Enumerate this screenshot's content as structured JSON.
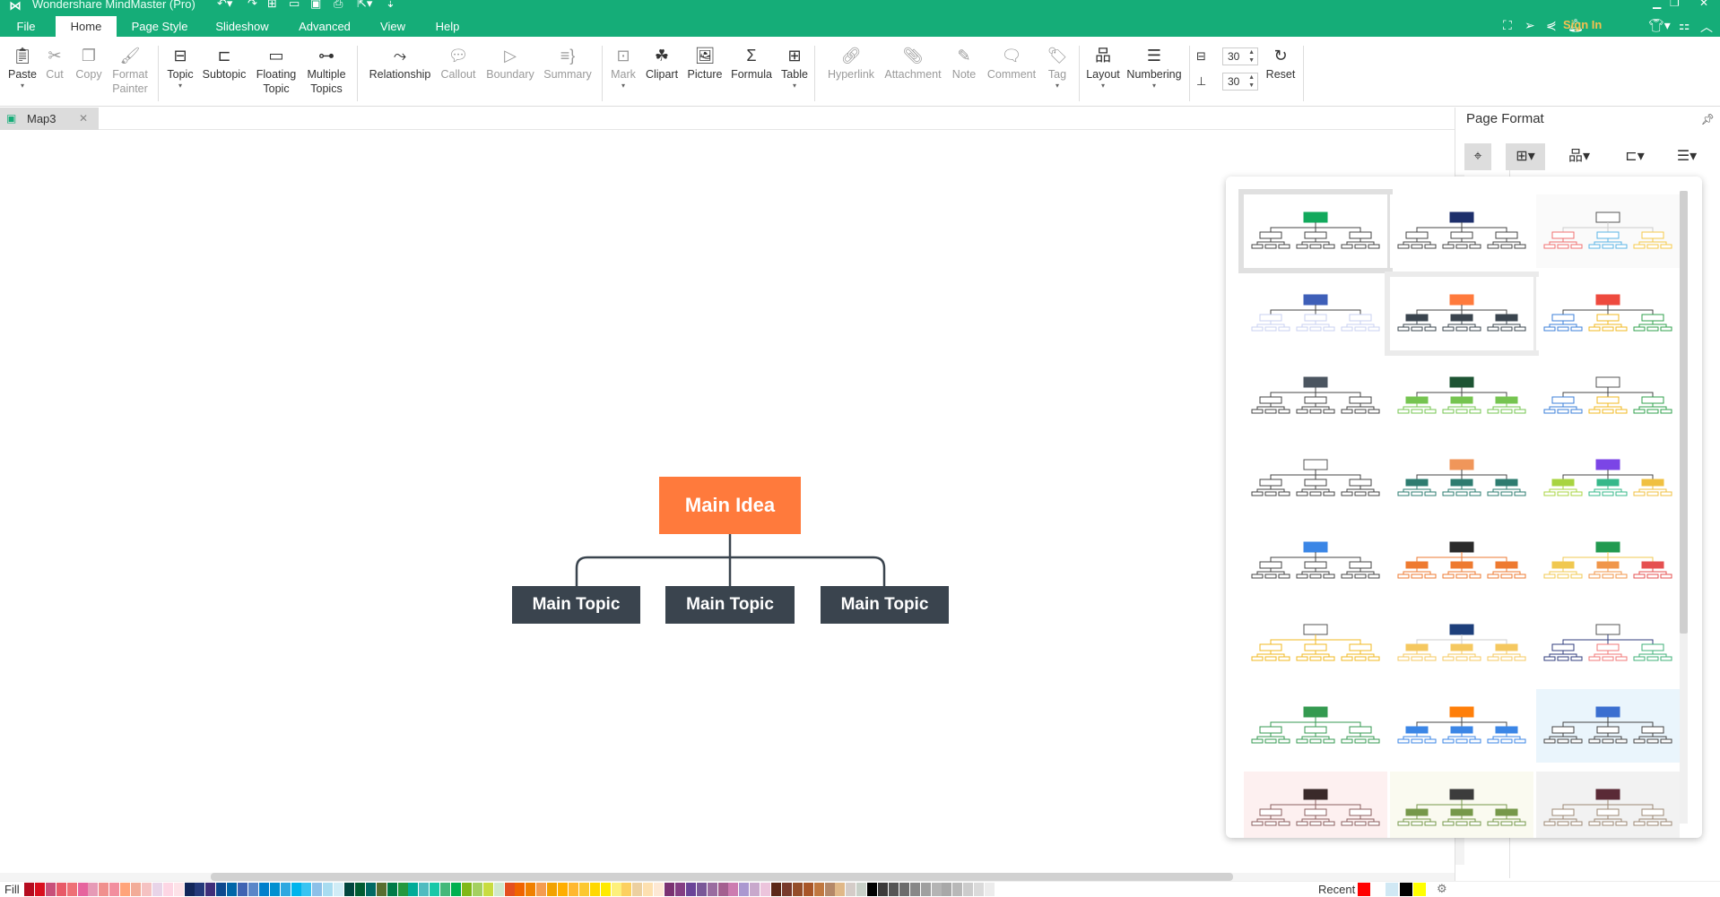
{
  "app": {
    "title": "Wondershare MindMaster (Pro)",
    "logo_icon": "mindmaster-logo-icon"
  },
  "quick_access": [
    "undo-icon",
    "redo-icon",
    "new-icon",
    "open-icon",
    "save-icon",
    "print-icon",
    "export-icon",
    "customize-icon"
  ],
  "menu": {
    "items": [
      "File",
      "Home",
      "Page Style",
      "Slideshow",
      "Advanced",
      "View",
      "Help"
    ],
    "active": "Home"
  },
  "topright": {
    "sign_in": "Sign In"
  },
  "ribbon": {
    "groups": [
      [
        {
          "label": "Paste",
          "icon": "paste-icon",
          "disabled": false,
          "dropdown": true
        },
        {
          "label": "Cut",
          "icon": "cut-icon",
          "disabled": true
        },
        {
          "label": "Copy",
          "icon": "copy-icon",
          "disabled": true
        },
        {
          "label": "Format\nPainter",
          "icon": "format-painter-icon",
          "disabled": true
        }
      ],
      [
        {
          "label": "Topic",
          "icon": "topic-icon",
          "disabled": false,
          "dropdown": true
        },
        {
          "label": "Subtopic",
          "icon": "subtopic-icon",
          "disabled": false
        },
        {
          "label": "Floating\nTopic",
          "icon": "floating-topic-icon",
          "disabled": false
        },
        {
          "label": "Multiple\nTopics",
          "icon": "multiple-topics-icon",
          "disabled": false
        }
      ],
      [
        {
          "label": "Relationship",
          "icon": "relationship-icon",
          "disabled": false
        },
        {
          "label": "Callout",
          "icon": "callout-icon",
          "disabled": true
        },
        {
          "label": "Boundary",
          "icon": "boundary-icon",
          "disabled": true
        },
        {
          "label": "Summary",
          "icon": "summary-icon",
          "disabled": true
        }
      ],
      [
        {
          "label": "Mark",
          "icon": "mark-icon",
          "disabled": true,
          "dropdown": true
        },
        {
          "label": "Clipart",
          "icon": "clipart-icon",
          "disabled": false
        },
        {
          "label": "Picture",
          "icon": "picture-icon",
          "disabled": false
        },
        {
          "label": "Formula",
          "icon": "formula-icon",
          "disabled": false
        },
        {
          "label": "Table",
          "icon": "table-icon",
          "disabled": false,
          "dropdown": true
        }
      ],
      [
        {
          "label": "Hyperlink",
          "icon": "hyperlink-icon",
          "disabled": true
        },
        {
          "label": "Attachment",
          "icon": "attachment-icon",
          "disabled": true
        },
        {
          "label": "Note",
          "icon": "note-icon",
          "disabled": true
        },
        {
          "label": "Comment",
          "icon": "comment-icon",
          "disabled": true
        },
        {
          "label": "Tag",
          "icon": "tag-icon",
          "disabled": true,
          "dropdown": true
        }
      ],
      [
        {
          "label": "Layout",
          "icon": "layout-icon",
          "disabled": false,
          "dropdown": true
        },
        {
          "label": "Numbering",
          "icon": "numbering-icon",
          "disabled": false,
          "dropdown": true
        }
      ]
    ],
    "spacing": {
      "horizontal_value": "30",
      "vertical_value": "30",
      "reset_label": "Reset"
    }
  },
  "document_tab": {
    "name": "Map3"
  },
  "mindmap": {
    "root": {
      "label": "Main Idea",
      "color": "#ff7a3c"
    },
    "topics": [
      {
        "label": "Main Topic",
        "color": "#3a444e"
      },
      {
        "label": "Main Topic",
        "color": "#3a444e"
      },
      {
        "label": "Main Topic",
        "color": "#3a444e"
      }
    ],
    "connector_color": "#3a444e"
  },
  "page_format": {
    "title": "Page Format",
    "toolbar": [
      "format-icon",
      "theme-icon",
      "layout-structure-icon",
      "connector-style-icon",
      "numbering-list-icon"
    ],
    "selected_tool": "theme-icon"
  },
  "themes": [
    {
      "root": "#12a95c",
      "topic": "outline",
      "topicColor": "#444",
      "line": "#444",
      "bg": "#ffffff",
      "selected": true
    },
    {
      "root": "#1d2f6b",
      "topic": "outline",
      "topicColor": "#444",
      "line": "#444",
      "bg": "#ffffff"
    },
    {
      "root": "outline",
      "topic": "outline",
      "multi": [
        "#f07070",
        "#5bb4e6",
        "#f5c94a"
      ],
      "line": "#ccc",
      "bg": "#fafafa"
    },
    {
      "root": "#3e5fb8",
      "topic": "outline",
      "topicColor": "#c9d0f2",
      "line": "#444",
      "bg": "#ffffff"
    },
    {
      "root": "#ff7a3c",
      "topic": "fill",
      "topicColor": "#3a444e",
      "line": "#444",
      "bg": "#ffffff",
      "selected2": true
    },
    {
      "root": "#ee4a3e",
      "topic": "outline",
      "multi": [
        "#3b7fd8",
        "#f0b820",
        "#30a24e"
      ],
      "line": "#444",
      "bg": "#ffffff"
    },
    {
      "root": "#4b5560",
      "topic": "outline",
      "topicColor": "#444",
      "line": "#444",
      "bg": "#ffffff"
    },
    {
      "root": "#1d5433",
      "topic": "fill",
      "topicColor": "#75c450",
      "line": "#444",
      "bg": "#ffffff"
    },
    {
      "root": "outline",
      "topic": "outline",
      "multi": [
        "#3b7fd8",
        "#f0b820",
        "#30a24e"
      ],
      "line": "#444",
      "bg": "#ffffff"
    },
    {
      "root": "outline",
      "topic": "outline",
      "topicColor": "#444",
      "line": "#444",
      "bg": "#ffffff"
    },
    {
      "root": "#f0965a",
      "topic": "fill",
      "topicColor": "#2e7c70",
      "line": "#444",
      "bg": "#ffffff"
    },
    {
      "root": "#7b45e6",
      "topic": "fill",
      "multi": [
        "#a8d440",
        "#36b88a",
        "#f0c040"
      ],
      "line": "#444",
      "bg": "#ffffff"
    },
    {
      "root": "#3b86e6",
      "topic": "outline",
      "topicColor": "#444",
      "line": "#444",
      "bg": "#ffffff"
    },
    {
      "root": "#2a2a2a",
      "topic": "fill",
      "topicColor": "#ee7a30",
      "line": "#ee7a30",
      "bg": "#ffffff"
    },
    {
      "root": "#229a50",
      "topic": "fill",
      "multi": [
        "#f0c850",
        "#f0964a",
        "#e55050"
      ],
      "line": "#f0c850",
      "bg": "#ffffff"
    },
    {
      "root": "outline",
      "topic": "outline",
      "topicColor": "#f0b820",
      "line": "#f0b820",
      "bg": "#ffffff"
    },
    {
      "root": "#1d3f7b",
      "topic": "fill",
      "topicColor": "#f5c860",
      "line": "#ccc",
      "bg": "#ffffff"
    },
    {
      "root": "outline",
      "topic": "outline",
      "multi": [
        "#303c7c",
        "#f07878",
        "#40b07a"
      ],
      "line": "#303c7c",
      "bg": "#ffffff"
    },
    {
      "root": "#349a50",
      "topic": "outline",
      "topicColor": "#349a50",
      "line": "#349a50",
      "bg": "#ffffff"
    },
    {
      "root": "#ff7f0a",
      "topic": "fill",
      "topicColor": "#3b86e6",
      "line": "#444",
      "bg": "#ffffff"
    },
    {
      "root": "#3b6fd0",
      "topic": "outline",
      "topicColor": "#444",
      "line": "#444",
      "bg": "#eaf5fc"
    },
    {
      "root": "#3a2a2a",
      "topic": "outline",
      "topicColor": "#8c6060",
      "line": "#8c6060",
      "bg": "#fdf0f0"
    },
    {
      "root": "#3c3c3c",
      "topic": "fill",
      "topicColor": "#76984a",
      "line": "#76984a",
      "bg": "#fafaf0"
    },
    {
      "root": "#5a2a36",
      "topic": "outline",
      "topicColor": "#9c8874",
      "line": "#9c8874",
      "bg": "#f2f2f2"
    }
  ],
  "color_bar": {
    "fill_label": "Fill",
    "swatches": [
      "#b50c1f",
      "#d9101f",
      "#c8507a",
      "#e85a68",
      "#ee7076",
      "#e6649e",
      "#e69ab6",
      "#f0908e",
      "#f28e9e",
      "#ffa47a",
      "#f2ac98",
      "#f5c2c2",
      "#e8d4e8",
      "#fdd6e4",
      "#fde2e8",
      "#12265a",
      "#24397a",
      "#3e2e7a",
      "#0c488e",
      "#0066a8",
      "#3f63b2",
      "#5a86c8",
      "#0080cc",
      "#0090d0",
      "#2ea8e0",
      "#00b4ec",
      "#38c4f2",
      "#8cc0e8",
      "#a8dcf0",
      "#d0ecf6",
      "#00463e",
      "#005c32",
      "#006a64",
      "#586e30",
      "#007a48",
      "#24983e",
      "#00ac98",
      "#50bcc0",
      "#18c8a8",
      "#44b87a",
      "#00b050",
      "#80b818",
      "#a4d060",
      "#c8dc40",
      "#d0e8cc",
      "#e45020",
      "#f06400",
      "#f08000",
      "#f49c50",
      "#f2a200",
      "#ffae00",
      "#ffb830",
      "#fcc830",
      "#ffd800",
      "#ffea00",
      "#fdf07c",
      "#fcd060",
      "#ecd0a0",
      "#fde0b0",
      "#fde8d4",
      "#7a3272",
      "#843e84",
      "#6a4498",
      "#7a5898",
      "#9a6ca0",
      "#a46090",
      "#cc7cb0",
      "#aa98d0",
      "#c8a8cc",
      "#ecc4dc",
      "#5c2818",
      "#783a2c",
      "#944e2a",
      "#a85628",
      "#c07840",
      "#b48868",
      "#e0b888",
      "#d4ccc8",
      "#c8d0c8",
      "#000000",
      "#3c3a3a",
      "#565656",
      "#6c6c6c",
      "#888888",
      "#a0a0a0",
      "#b4b4b4",
      "#a8a8a8",
      "#b8b8b8",
      "#cccccc",
      "#dadada",
      "#ececec"
    ],
    "recent_label": "Recent",
    "recent": [
      "#ff0000",
      "#ffffff",
      "#d0e8f4",
      "#000000",
      "#ffff00"
    ],
    "more_colors_icon": "palette-icon"
  }
}
